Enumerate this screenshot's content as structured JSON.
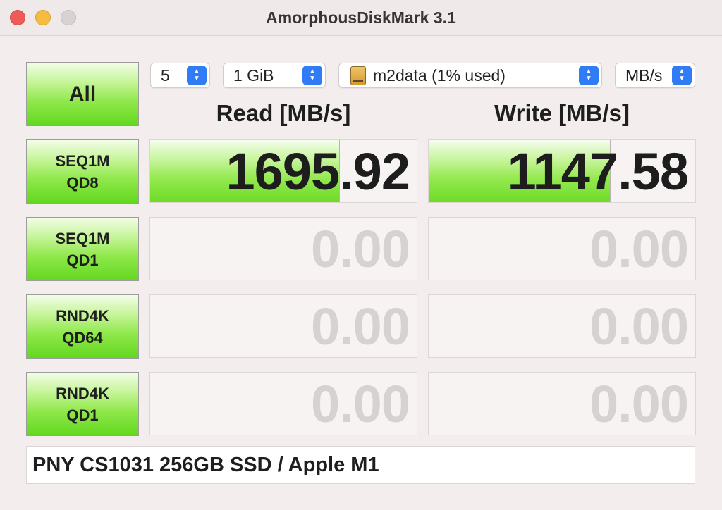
{
  "window": {
    "title": "AmorphousDiskMark 3.1"
  },
  "controls": {
    "all_label": "All",
    "count": {
      "value": "5"
    },
    "size": {
      "value": "1 GiB"
    },
    "drive": {
      "value": "m2data (1% used)",
      "icon": "hard-drive-icon"
    },
    "unit": {
      "value": "MB/s"
    }
  },
  "headers": {
    "read": "Read [MB/s]",
    "write": "Write [MB/s]"
  },
  "tests": [
    {
      "line1": "SEQ1M",
      "line2": "QD8",
      "read": "1695.92",
      "write": "1147.58",
      "read_fill": 0.71,
      "write_fill": 0.68
    },
    {
      "line1": "SEQ1M",
      "line2": "QD1",
      "read": "0.00",
      "write": "0.00",
      "read_fill": 0,
      "write_fill": 0
    },
    {
      "line1": "RND4K",
      "line2": "QD64",
      "read": "0.00",
      "write": "0.00",
      "read_fill": 0,
      "write_fill": 0
    },
    {
      "line1": "RND4K",
      "line2": "QD1",
      "read": "0.00",
      "write": "0.00",
      "read_fill": 0,
      "write_fill": 0
    }
  ],
  "status": {
    "text": "PNY CS1031 256GB SSD / Apple M1"
  },
  "colors": {
    "accent_green": "#63d81f",
    "popup_blue": "#2f7cf6",
    "zero_text": "#d7d2d2"
  }
}
